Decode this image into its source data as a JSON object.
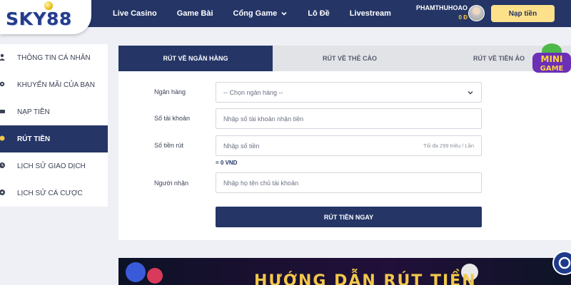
{
  "header": {
    "logo_text": "SKY88",
    "nav": [
      {
        "label": "Live Casino"
      },
      {
        "label": "Game Bài"
      },
      {
        "label": "Cổng Game",
        "dropdown": true
      },
      {
        "label": "Lô Đề"
      },
      {
        "label": "Livestream"
      }
    ],
    "username": "PHAMTHUHOAO",
    "balance": "0 Đ",
    "deposit_label": "Nạp tiền"
  },
  "sidebar": {
    "items": [
      {
        "label": "THÔNG TIN CÁ NHÂN",
        "icon": "person-icon",
        "active": false
      },
      {
        "label": "KHUYẾN MÃI CỦA BẠN",
        "icon": "gear-icon",
        "active": false
      },
      {
        "label": "NẠP TIỀN",
        "icon": "deposit-icon",
        "active": false
      },
      {
        "label": "RÚT TIỀN",
        "icon": "withdraw-icon",
        "active": true
      },
      {
        "label": "LỊCH SỬ GIAO DỊCH",
        "icon": "clock-icon",
        "active": false
      },
      {
        "label": "LỊCH SỬ CÁ CƯỢC",
        "icon": "ball-icon",
        "active": false
      }
    ]
  },
  "tabs": [
    {
      "label": "RÚT VỀ NGÂN HÀNG",
      "active": true
    },
    {
      "label": "RÚT VỀ THẺ CÀO",
      "active": false
    },
    {
      "label": "RÚT VỀ TIỀN ẢO",
      "active": false
    }
  ],
  "form": {
    "bank_label": "Ngân hàng",
    "bank_value": "-- Chọn ngân hàng --",
    "account_label": "Số tài khoản",
    "account_placeholder": "Nhập số tài khoản nhận tiền",
    "amount_label": "Số tiền rút",
    "amount_placeholder": "Nhập số tiền",
    "amount_hint": "Tối đa 299 triệu / Lần",
    "conversion": "= 0 VND",
    "receiver_label": "Người nhận",
    "receiver_placeholder": "Nhập họ tên chủ tài khoản",
    "submit_label": "RÚT TIỀN NGAY"
  },
  "mini_game": {
    "line1": "MINI",
    "line2": "GAME"
  },
  "banner": {
    "text": "HƯỚNG DẪN RÚT TIỀN"
  },
  "colors": {
    "primary": "#243566",
    "accent": "#fde08a",
    "gold": "#f2c84b",
    "background": "#eef0f5"
  }
}
